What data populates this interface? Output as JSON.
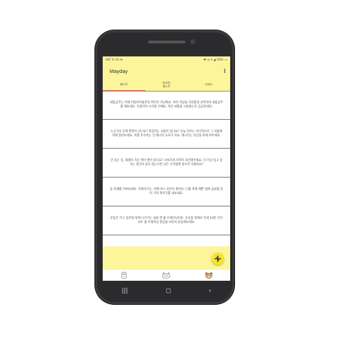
{
  "status_bar": {
    "left": "SKT 6:16 ⊟",
    "right": "✱ ◎ ▾ ◢ 58% ▭"
  },
  "app": {
    "title": "Mayday"
  },
  "tabs": [
    {
      "label": "퀘스트",
      "active": true
    },
    {
      "label": "완료된\n퀘스트",
      "active": false
    },
    {
      "label": "리워드",
      "active": false
    }
  ],
  "quests": [
    "새침공부는 이제 어렵어이돌만의 취미가 아닌배요. 여러 색상을 자유롭게 선택하여 새침공부를 해보세요. 진생각이 시작될 거예요. 색만 새칠을 시용할는지 궁금하네요!",
    "누군가로 인해 뿌쥬이 났나요? 화장하는 사람이 있나요? 오늘 하루는 의식적으로 그 사람에 대해 찾아보세요. 희를 추가하는 건 에너지 소모가 커요. 에너지는 당신을 위해 써주세요.",
    "안 입는 옷, 재생이 지난 책이 쌓아 있나요? 사숙하게 자역이 보관해주세요. 더 이상 입고 싶지는 생각이 들지 않는다면 모든 수거함에 넣으러 가볼까요?",
    "동 카페를 가벼보세요. 미케이기는, 하배 쉬스 되은이 좋아요. 나를 위해 예쁜 컵에 음료를 담아 가져 찍어기를 내보세요.",
    "운동은 하고 싶은데 밖에 나가기는 싫을 땐 홈 트레이닝이죠. 조깅을 위해서 딱게 10분 인이의로 홈 트레이닝 영상을 보면서 운동해보세요."
  ],
  "icons": {
    "fab": "add-quest-icon",
    "nav": [
      "bunny-icon",
      "cat-icon",
      "bear-icon"
    ],
    "system": [
      "recents-icon",
      "home-icon",
      "back-icon"
    ]
  },
  "colors": {
    "accent_yellow": "#fdf59a",
    "fab_yellow": "#f7e52b",
    "tab_indicator": "#e46a5d",
    "phone_body": "#2b2b2d"
  },
  "system_nav": {
    "recents": "|||",
    "home": "◻",
    "back": "‹"
  }
}
